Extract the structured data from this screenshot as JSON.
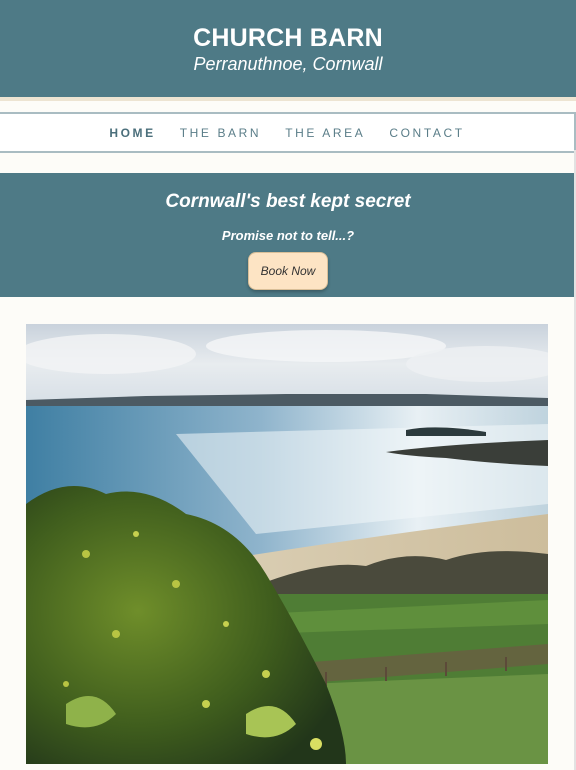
{
  "header": {
    "title": "CHURCH BARN",
    "subtitle": "Perranuthnoe, Cornwall",
    "bg_color": "#4e7a86"
  },
  "nav": {
    "items": [
      {
        "label": "HOME",
        "active": true
      },
      {
        "label": "THE BARN",
        "active": false
      },
      {
        "label": "THE AREA",
        "active": false
      },
      {
        "label": "CONTACT",
        "active": false
      }
    ]
  },
  "hero": {
    "title": "Cornwall's best kept secret",
    "subtitle": "Promise not to tell...?",
    "button_label": "Book Now",
    "button_color": "#fde4c4"
  },
  "photo": {
    "subject": "coastal-bay-landscape"
  }
}
